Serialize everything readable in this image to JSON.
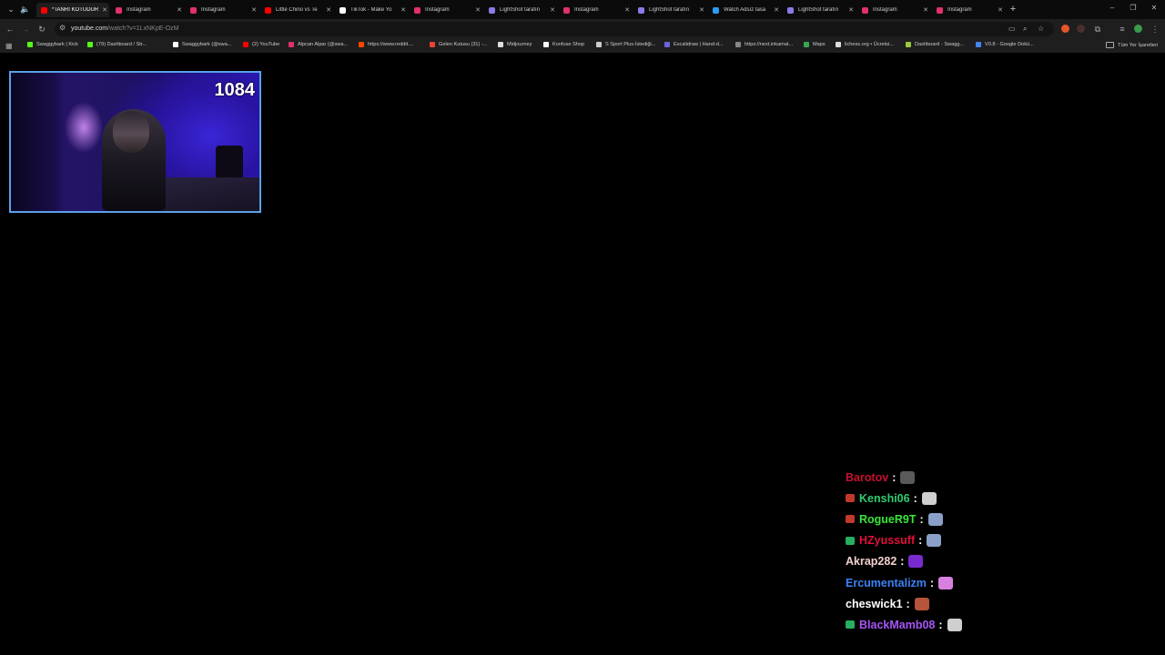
{
  "browser": {
    "tabs": [
      {
        "label": "*TANRI KÖTÜDÜR",
        "favicon": "youtube-icon",
        "color": "#ff0000",
        "active": true
      },
      {
        "label": "Instagram",
        "favicon": "instagram-icon",
        "color": "#e1306c"
      },
      {
        "label": "Instagram",
        "favicon": "instagram-icon",
        "color": "#e1306c"
      },
      {
        "label": "Little Chino vs Te",
        "favicon": "youtube-icon",
        "color": "#ff0000"
      },
      {
        "label": "TikTok - Make Yo",
        "favicon": "tiktok-icon",
        "color": "#ffffff"
      },
      {
        "label": "Instagram",
        "favicon": "instagram-icon",
        "color": "#e1306c"
      },
      {
        "label": "LightShot tarafın",
        "favicon": "lightshot-icon",
        "color": "#8a7be8"
      },
      {
        "label": "Instagram",
        "favicon": "instagram-icon",
        "color": "#e1306c"
      },
      {
        "label": "LightShot tarafın",
        "favicon": "lightshot-icon",
        "color": "#8a7be8"
      },
      {
        "label": "Watch Adsız tasa",
        "favicon": "globe-icon",
        "color": "#2b9bf4"
      },
      {
        "label": "LightShot tarafın",
        "favicon": "lightshot-icon",
        "color": "#8a7be8"
      },
      {
        "label": "Instagram",
        "favicon": "instagram-icon",
        "color": "#e1306c"
      },
      {
        "label": "Instagram",
        "favicon": "instagram-icon",
        "color": "#e1306c"
      }
    ],
    "new_tab_label": "+",
    "window_controls": {
      "minimize": "–",
      "maximize": "❐",
      "close": "✕"
    },
    "url": {
      "host": "youtube.com",
      "path": "/watch?v=1LxNKpE-OzM"
    },
    "bookmarks": [
      {
        "label": "Swaggybark | Kick",
        "color": "#53fc18"
      },
      {
        "label": "(79) Dashboard / Str...",
        "color": "#53fc18"
      },
      {
        "label": "Swaggybark (@swa...",
        "color": "#ffffff"
      },
      {
        "label": "(2) YouTube",
        "color": "#ff0000"
      },
      {
        "label": "Alpcan Alpar (@swa...",
        "color": "#e1306c"
      },
      {
        "label": "https://www.reddit....",
        "color": "#ff4500"
      },
      {
        "label": "Gelen Kutusu (31) -...",
        "color": "#ea4335"
      },
      {
        "label": "Midjourney",
        "color": "#dddddd"
      },
      {
        "label": "Konfuse Shop",
        "color": "#ffffff"
      },
      {
        "label": "S Sport Plus-İstediği...",
        "color": "#cccccc"
      },
      {
        "label": "Excalidraw | Hand-d...",
        "color": "#6965db"
      },
      {
        "label": "https://next.inkamat...",
        "color": "#888888"
      },
      {
        "label": "Maps",
        "color": "#34a853"
      },
      {
        "label": "lichess.org • Ücretsi...",
        "color": "#dddddd"
      },
      {
        "label": "Dashboard - Swagg...",
        "color": "#9aca3c"
      },
      {
        "label": "V0.8 - Google Dokü...",
        "color": "#4285f4"
      }
    ],
    "all_bookmarks_label": "Tüm Yer İşaretleri"
  },
  "overlay": {
    "counter": "1084"
  },
  "chat": [
    {
      "user": "Barotov",
      "color": "#c8102e",
      "badge": "",
      "emote_color": "#5a5a5a"
    },
    {
      "user": "Kenshi06",
      "color": "#2ecc71",
      "badge": "#c0392b",
      "emote_color": "#cfcfcf"
    },
    {
      "user": "RogueR9T",
      "color": "#39e639",
      "badge": "#c0392b",
      "emote_color": "#8aa0c8"
    },
    {
      "user": "HZyussuff",
      "color": "#e0103a",
      "badge": "#27ae60",
      "emote_color": "#8aa0c8"
    },
    {
      "user": "Akrap282",
      "color": "#f5d0d0",
      "badge": "",
      "emote_color": "#7a2bd0"
    },
    {
      "user": "Ercumentalizm",
      "color": "#3b82f6",
      "badge": "",
      "emote_color": "#d880e0"
    },
    {
      "user": "cheswick1",
      "color": "#ffffff",
      "badge": "",
      "emote_color": "#b5543a"
    },
    {
      "user": "BlackMamb08",
      "color": "#a855f7",
      "badge": "#27ae60",
      "emote_color": "#cfcfcf"
    }
  ],
  "chat_separator": ":"
}
